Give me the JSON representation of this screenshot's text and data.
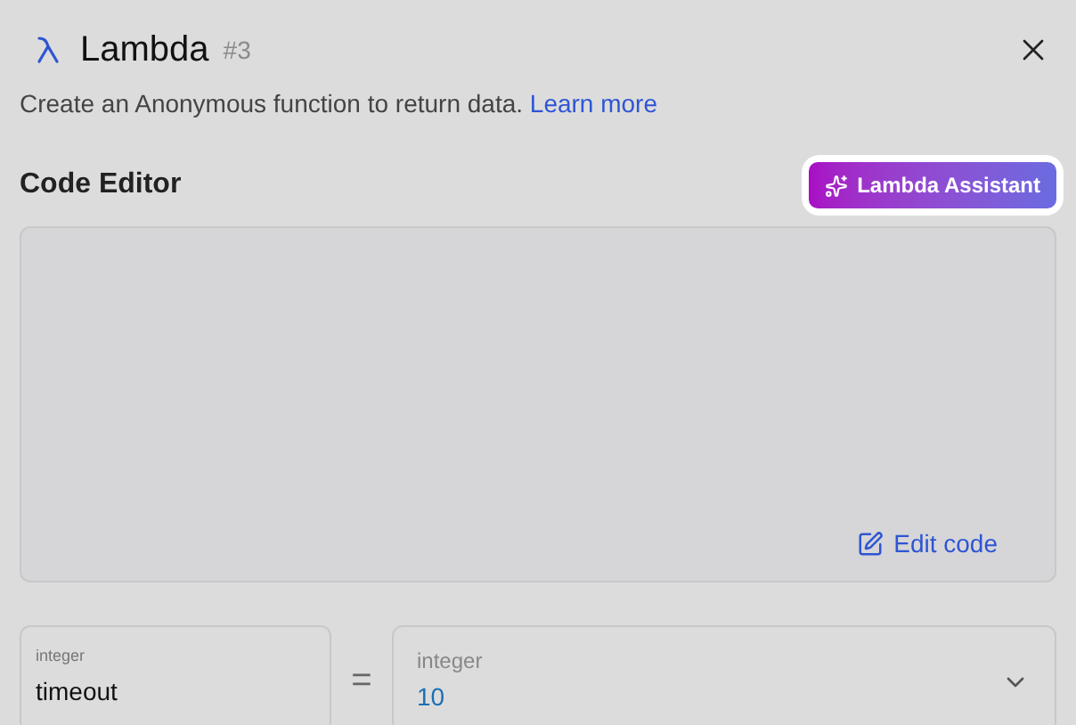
{
  "header": {
    "title": "Lambda",
    "number": "#3"
  },
  "description": {
    "text": "Create an Anonymous function to return data.",
    "link": "Learn more"
  },
  "code_editor": {
    "title": "Code Editor",
    "assistant_button": "Lambda Assistant",
    "edit_button": "Edit code"
  },
  "parameter": {
    "name_type": "integer",
    "name": "timeout",
    "operator": "=",
    "value_type": "integer",
    "value": "10"
  }
}
